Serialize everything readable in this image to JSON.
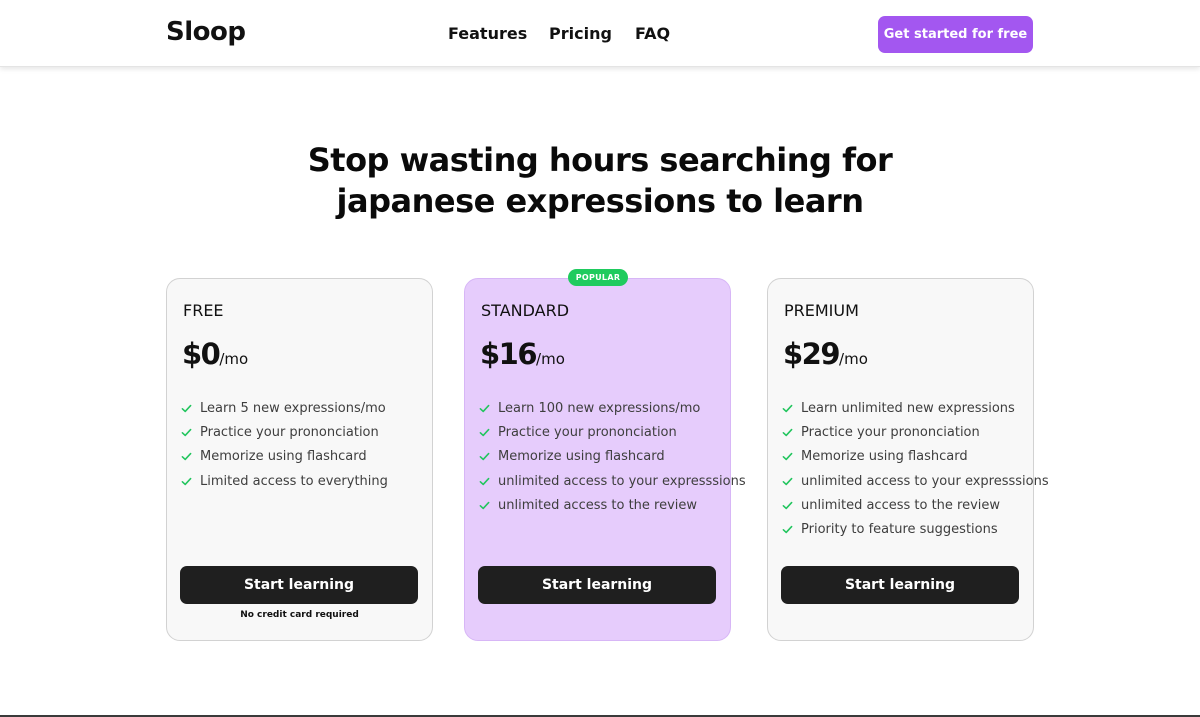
{
  "header": {
    "logo": "Sloop",
    "nav": [
      {
        "label": "Features"
      },
      {
        "label": "Pricing"
      },
      {
        "label": "FAQ"
      }
    ],
    "cta_label": "Get started for free"
  },
  "hero": {
    "line1": "Stop wasting hours searching for",
    "line2": "japanese expressions to learn"
  },
  "plans": [
    {
      "name": "FREE",
      "price": "$0",
      "period": "/mo",
      "features": [
        "Learn 5 new expressions/mo",
        "Practice your prononciation",
        "Memorize using flashcard",
        "Limited access to everything"
      ],
      "button_label": "Start learning",
      "note": "No credit card required"
    },
    {
      "name": "STANDARD",
      "badge": "POPULAR",
      "price": "$16",
      "period": "/mo",
      "features": [
        "Learn 100 new expressions/mo",
        "Practice your prononciation",
        "Memorize using flashcard",
        "unlimited access to your expresssions",
        "unlimited access to the review"
      ],
      "button_label": "Start learning"
    },
    {
      "name": "PREMIUM",
      "price": "$29",
      "period": "/mo",
      "features": [
        "Learn unlimited new expressions",
        "Practice your prononciation",
        "Memorize using flashcard",
        "unlimited access to your expresssions",
        "unlimited access to the review",
        "Priority to feature suggestions"
      ],
      "button_label": "Start learning"
    }
  ],
  "colors": {
    "brand_purple": "#a357f0",
    "popular_card_bg": "#e6ccfc",
    "badge_green": "#1fcb5e",
    "check_green": "#22c55e",
    "button_dark": "#1f1f1f"
  },
  "icons": {
    "feature_bullet": "check-icon"
  }
}
